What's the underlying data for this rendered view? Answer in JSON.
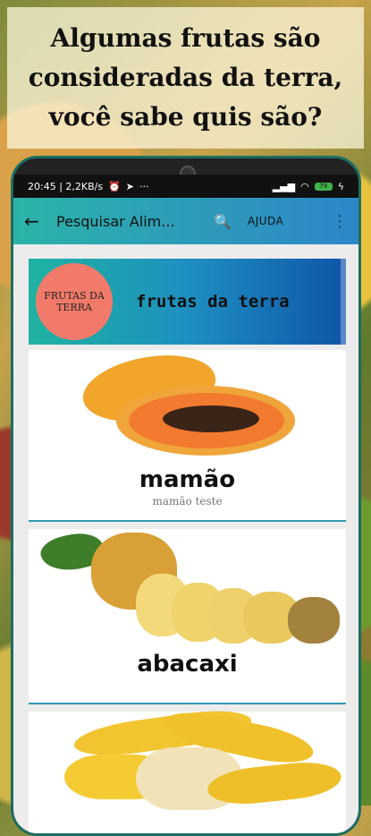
{
  "headline": "Algumas  frutas são consideradas da terra, você sabe quis são?",
  "statusbar": {
    "left": "20:45 | 2,2KB/s",
    "dots": "···",
    "battery": "79"
  },
  "appbar": {
    "back": "←",
    "title": "Pesquisar Alim...",
    "search": "🔍",
    "help": "AJUDA",
    "more": "⋮"
  },
  "banner": {
    "logo_text": "FRUTAS DA TERRA",
    "title": "frutas da terra"
  },
  "cards": [
    {
      "name": "mamão",
      "subtitle": "mamão teste"
    },
    {
      "name": "abacaxi",
      "subtitle": ""
    },
    {
      "name": "",
      "subtitle": ""
    }
  ]
}
